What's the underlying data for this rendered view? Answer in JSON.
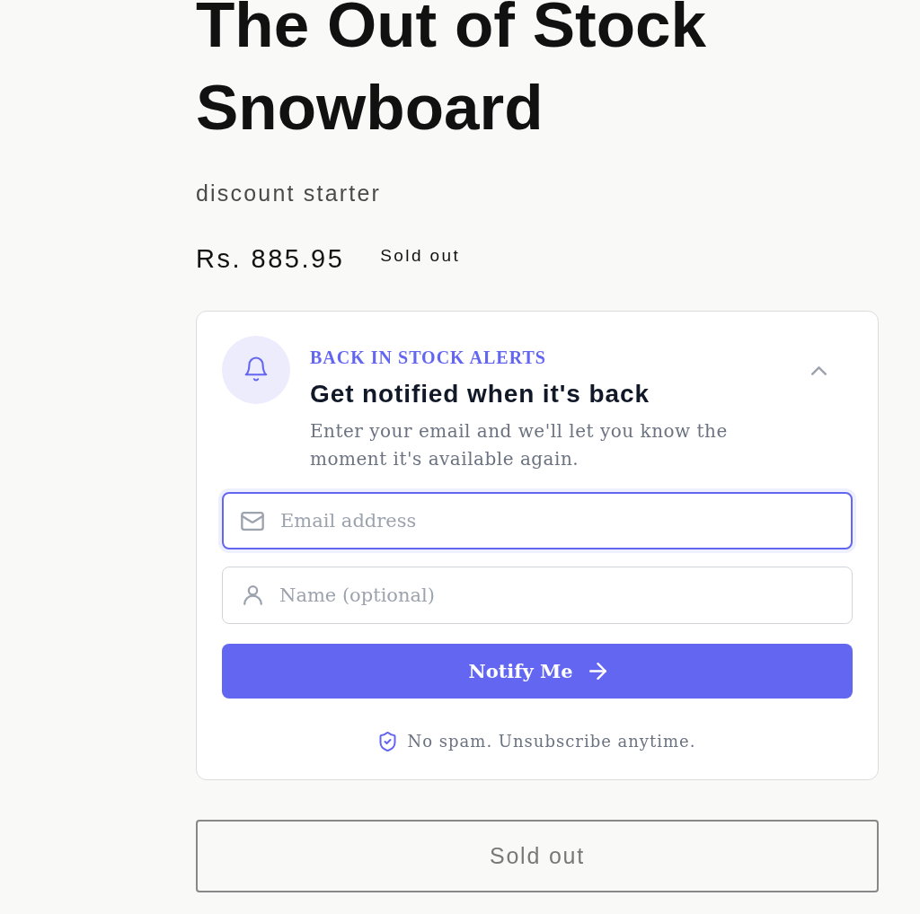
{
  "product": {
    "title": "The Out of Stock Snowboard",
    "vendor": "discount starter",
    "price": "Rs. 885.95",
    "status": "Sold out"
  },
  "alert_card": {
    "expanded": true,
    "eyebrow": "BACK IN STOCK ALERTS",
    "heading": "Get notified when it's back",
    "description": "Enter your email and we'll let you know the moment it's available again.",
    "fields": [
      {
        "kind": "email",
        "placeholder": "Email address",
        "focused": true
      },
      {
        "kind": "name",
        "placeholder": "Name (optional)",
        "focused": false
      }
    ],
    "submit": {
      "label": "Notify Me"
    },
    "note": "No spam. Unsubscribe anytime."
  },
  "buy_button": {
    "label": "Sold out",
    "disabled": true
  }
}
